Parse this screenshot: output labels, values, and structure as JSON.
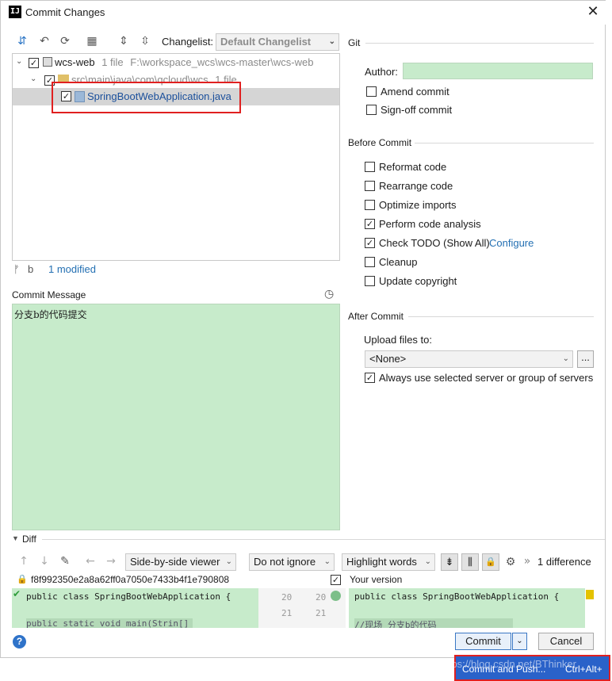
{
  "window": {
    "title": "Commit Changes",
    "app_icon": "IJ"
  },
  "toolbar": {
    "changelist_label": "Changelist:",
    "changelist_value": "Default Changelist"
  },
  "tree": {
    "root_label": "wcs-web",
    "root_count": "1 file",
    "root_path": "F:\\workspace_wcs\\wcs-master\\wcs-web",
    "folder_label": "src\\main\\java\\com\\qcloud\\wcs",
    "folder_count": "1 file",
    "file_label": "SpringBootWebApplication.java"
  },
  "status": {
    "branch": "b",
    "modified": "1 modified"
  },
  "commit_message": {
    "label": "Commit Message",
    "text": "分支b的代码提交"
  },
  "git": {
    "title": "Git",
    "author_label": "Author:",
    "author_value": "",
    "amend_label": "Amend commit",
    "signoff_label": "Sign-off commit"
  },
  "before_commit": {
    "title": "Before Commit",
    "options": [
      {
        "label": "Reformat code",
        "checked": false
      },
      {
        "label": "Rearrange code",
        "checked": false
      },
      {
        "label": "Optimize imports",
        "checked": false
      },
      {
        "label": "Perform code analysis",
        "checked": true
      },
      {
        "label": "Check TODO (Show All)",
        "checked": true
      },
      {
        "label": "Cleanup",
        "checked": false
      },
      {
        "label": "Update copyright",
        "checked": false
      }
    ],
    "configure_link": "Configure"
  },
  "after_commit": {
    "title": "After Commit",
    "upload_label": "Upload files to:",
    "upload_value": "<None>",
    "browse_label": "...",
    "always_label": "Always use selected server or group of servers"
  },
  "diff": {
    "title": "Diff",
    "viewer": "Side-by-side viewer",
    "ignore": "Do not ignore",
    "highlight": "Highlight words",
    "difference_count": "1 difference",
    "left_hash": "f8f992350e2a8a62ff0a7050e7433b4f1e790808",
    "right_label": "Your version",
    "left_code": "public class SpringBootWebApplication {",
    "right_code": "public class SpringBootWebApplication {",
    "line_numbers_left": [
      "20",
      "21"
    ],
    "line_numbers_right": [
      "20",
      "21"
    ],
    "left_code_line3": "public static void main(Strin[] args) {",
    "right_code_line3": "//现场 分支b的代码"
  },
  "buttons": {
    "commit": "Commit",
    "cancel": "Cancel",
    "help": "?"
  },
  "popup": {
    "label": "Commit and Push...",
    "shortcut": "Ctrl+Alt+"
  },
  "watermark": "https://blog.csdn.net/BThinker"
}
